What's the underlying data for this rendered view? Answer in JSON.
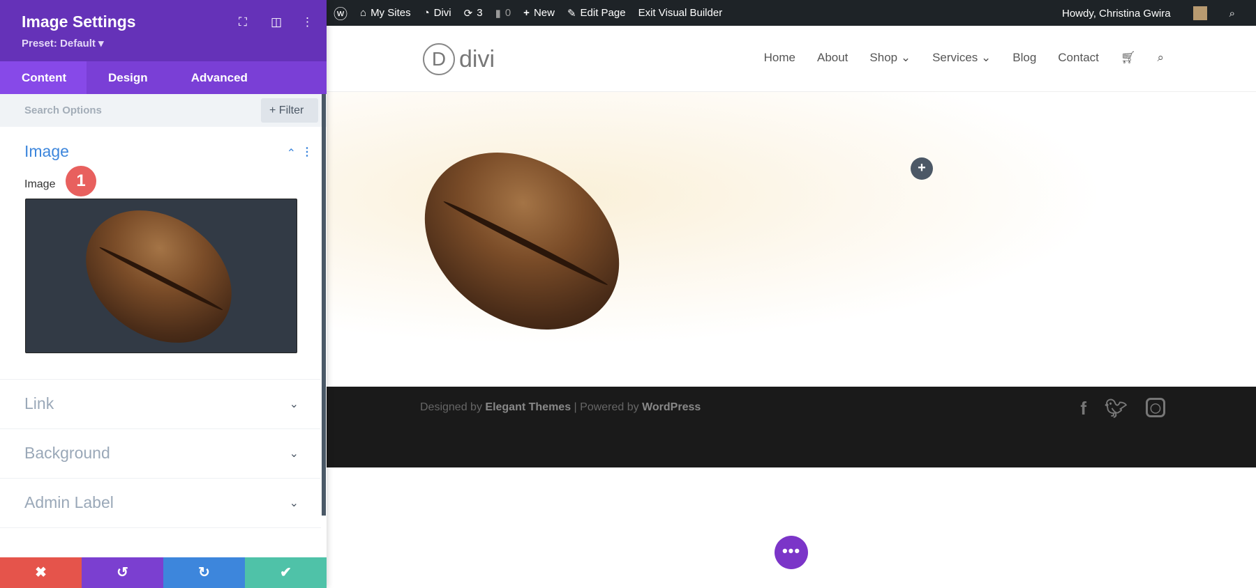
{
  "panel": {
    "title": "Image Settings",
    "preset": "Preset: Default ▾",
    "tabs": [
      "Content",
      "Design",
      "Advanced"
    ],
    "search_placeholder": "Search Options",
    "filter_label": "+ Filter",
    "sections": {
      "image": "Image",
      "image_field_label": "Image",
      "link": "Link",
      "background": "Background",
      "admin_label": "Admin Label"
    },
    "step_badge": "1",
    "bottom": {
      "cancel": "✖",
      "undo": "↺",
      "redo": "↻",
      "save": "✔"
    },
    "colors": {
      "header": "#6532b8",
      "cancel": "#e5544b",
      "undo": "#7b3fd0",
      "redo": "#3d86dc",
      "save": "#4fc2a8"
    }
  },
  "adminbar": {
    "items": [
      "My Sites",
      "Divi",
      "3",
      "0",
      "New",
      "Edit Page",
      "Exit Visual Builder"
    ],
    "greeting": "Howdy, Christina Gwira"
  },
  "site": {
    "logo": "divi",
    "logo_letter": "D",
    "nav": [
      "Home",
      "About",
      "Shop ⌄",
      "Services ⌄",
      "Blog",
      "Contact"
    ],
    "footer": {
      "designed_by": "Designed by ",
      "elegant": "Elegant Themes",
      "powered": " | Powered by ",
      "wordpress": "WordPress"
    },
    "social": [
      "f",
      "t",
      "ig"
    ]
  }
}
